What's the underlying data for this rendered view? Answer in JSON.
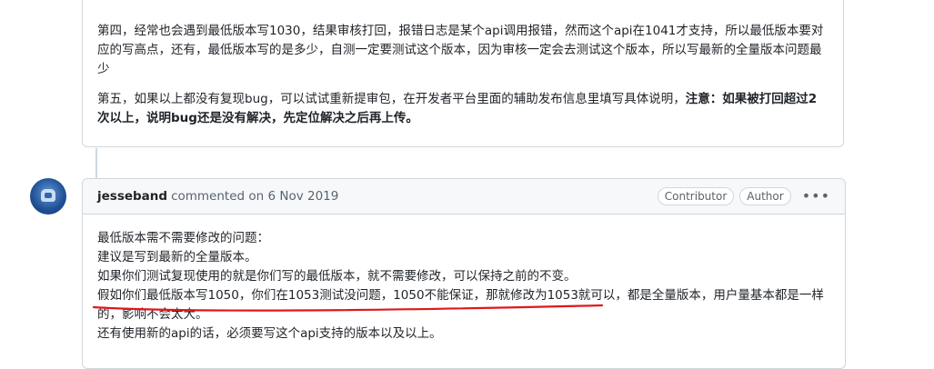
{
  "previous_comment": {
    "para4": "第四，经常也会遇到最低版本写1030，结果审核打回，报错日志是某个api调用报错，然而这个api在1041才支持，所以最低版本要对应的写高点，还有，最低版本写的是多少，自测一定要测试这个版本，因为审核一定会去测试这个版本，所以写最新的全量版本问题最少",
    "para5_normal": "第五，如果以上都没有复现bug，可以试试重新提审包，在开发者平台里面的辅助发布信息里填写具体说明，",
    "para5_bold": "注意：如果被打回超过2次以上，说明bug还是没有解决，先定位解决之后再上传。"
  },
  "comment": {
    "author": "jesseband",
    "meta": "commented on 6 Nov 2019",
    "badges": [
      "Contributor",
      "Author"
    ],
    "lines": [
      "最低版本需不需要修改的问题：",
      "建议是写到最新的全量版本。",
      "如果你们测试复现使用的就是你们写的最低版本，就不需要修改，可以保持之前的不变。",
      "假如你们最低版本写1050，你们在1053测试没问题，1050不能保证，那就修改为1053就可以，都是全量版本，用户量基本都是一样的，影响不会太大。",
      "还有使用新的api的话，必须要写这个api支持的版本以及以上。"
    ]
  },
  "colors": {
    "underline": "#e0171c",
    "border": "#d0d7de",
    "header_bg": "#f6f8fa"
  },
  "icons": {
    "avatar": "avatar-icon",
    "menu": "kebab-menu-icon"
  }
}
